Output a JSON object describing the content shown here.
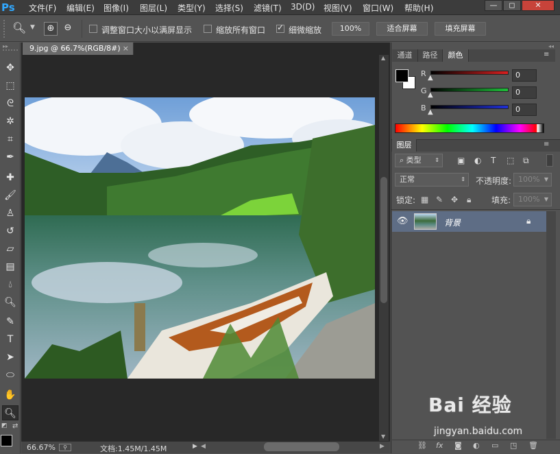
{
  "app": {
    "logo": "Ps"
  },
  "menu": [
    {
      "label": "文件(F)"
    },
    {
      "label": "编辑(E)"
    },
    {
      "label": "图像(I)"
    },
    {
      "label": "图层(L)"
    },
    {
      "label": "类型(Y)"
    },
    {
      "label": "选择(S)"
    },
    {
      "label": "滤镜(T)"
    },
    {
      "label": "3D(D)"
    },
    {
      "label": "视图(V)"
    },
    {
      "label": "窗口(W)"
    },
    {
      "label": "帮助(H)"
    }
  ],
  "window_buttons": {
    "minimize": "—",
    "restore": "◻",
    "close": "✕"
  },
  "options": {
    "resize_label": "调整窗口大小以满屏显示",
    "zoom_all_label": "缩放所有窗口",
    "scrubby_label": "细微缩放",
    "btn_100": "100%",
    "btn_fit": "适合屏幕",
    "btn_fill": "填充屏幕"
  },
  "document": {
    "tab_title": "9.jpg @ 66.7%(RGB/8#)",
    "tab_close": "×"
  },
  "status": {
    "zoom": "66.67%",
    "doc_info": "文档:1.45M/1.45M"
  },
  "panels": {
    "top_tabs": [
      "通道",
      "路径",
      "颜色"
    ],
    "color": {
      "channels": [
        {
          "label": "R",
          "value": "0",
          "color": "#d81f1f"
        },
        {
          "label": "G",
          "value": "0",
          "color": "#1fbf3a"
        },
        {
          "label": "B",
          "value": "0",
          "color": "#1f2fd8"
        }
      ]
    },
    "layers": {
      "tab": "图层",
      "filter_label": "类型",
      "blend_mode": "正常",
      "opacity_label": "不透明度:",
      "opacity_value": "100%",
      "lock_label": "锁定:",
      "fill_label": "填充:",
      "fill_value": "100%",
      "layer_name": "背景"
    }
  },
  "watermark": {
    "brand": "Bai 经验",
    "url": "jingyan.baidu.com"
  }
}
